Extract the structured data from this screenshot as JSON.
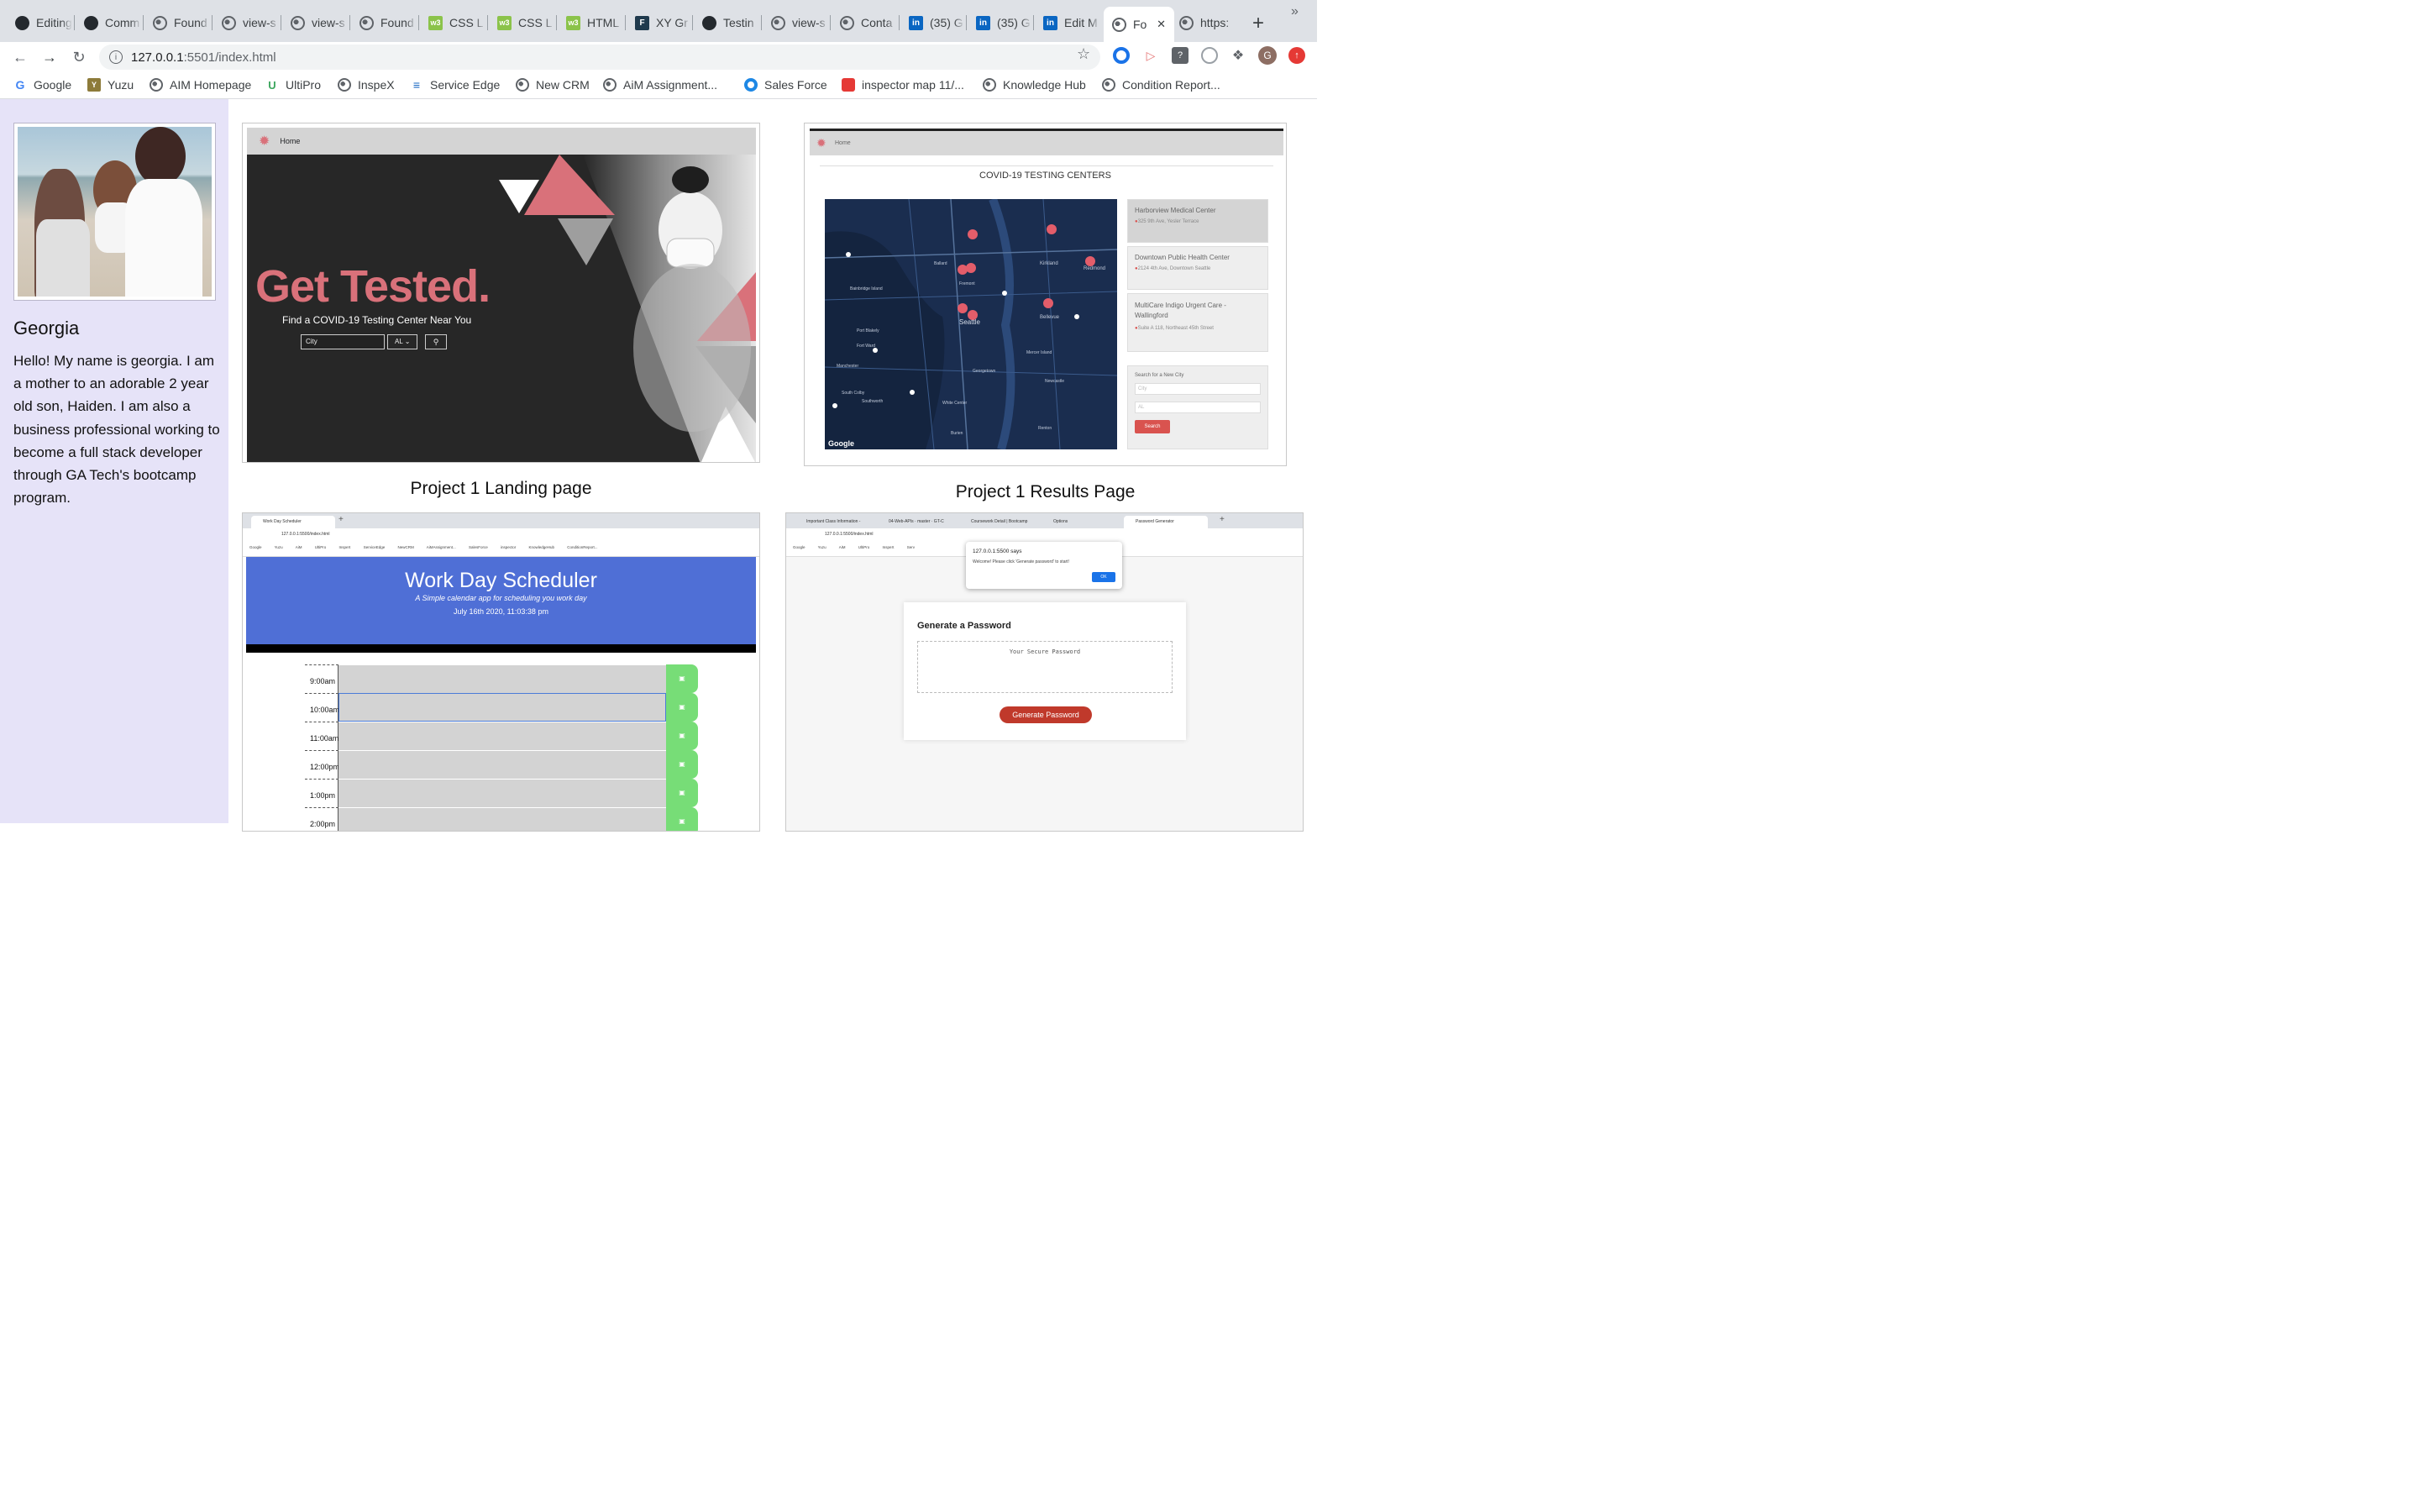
{
  "browser": {
    "tabs": [
      {
        "label": "Editing",
        "icon": "github-icon"
      },
      {
        "label": "Comm",
        "icon": "github-icon"
      },
      {
        "label": "Found",
        "icon": "globe-icon"
      },
      {
        "label": "view-s",
        "icon": "globe-icon"
      },
      {
        "label": "view-s",
        "icon": "globe-icon"
      },
      {
        "label": "Found",
        "icon": "globe-icon"
      },
      {
        "label": "CSS L",
        "icon": "w3schools-icon"
      },
      {
        "label": "CSS L",
        "icon": "w3schools-icon"
      },
      {
        "label": "HTML",
        "icon": "w3schools-icon"
      },
      {
        "label": "XY Gr",
        "icon": "figma-icon"
      },
      {
        "label": "Testin",
        "icon": "github-icon"
      },
      {
        "label": "view-s",
        "icon": "globe-icon"
      },
      {
        "label": "Conta",
        "icon": "globe-icon"
      },
      {
        "label": "(35) G",
        "icon": "linkedin-icon"
      },
      {
        "label": "(35) G",
        "icon": "linkedin-icon"
      },
      {
        "label": "Edit M",
        "icon": "linkedin-icon"
      },
      {
        "label": "Fo",
        "icon": "globe-icon",
        "active": true
      },
      {
        "label": "https:",
        "icon": "globe-icon"
      }
    ],
    "url": "127.0.0.1:5501/index.html",
    "url_host": "127.0.0.1",
    "url_rest": ":5501/index.html",
    "bookmarks": [
      "Google",
      "Yuzu",
      "AIM Homepage",
      "UltiPro",
      "InspeX",
      "Service Edge",
      "New CRM",
      "AiM Assignment...",
      "Sales Force",
      "inspector map 11/...",
      "Knowledge Hub",
      "Condition Report..."
    ],
    "bookmarks_more": "»",
    "profile_initial": "G"
  },
  "sidebar": {
    "name": "Georgia",
    "bio": "Hello! My name is georgia. I am a mother to an adorable 2 year old son, Haiden. I am also a business professional working to become a full stack developer through GA Tech's bootcamp program."
  },
  "projects": {
    "landing": {
      "caption": "Project 1 Landing page",
      "nav_home": "Home",
      "headline": "Get Tested.",
      "subhead": "Find a COVID-19 Testing Center Near You",
      "city_placeholder": "City",
      "state_value": "AL"
    },
    "results": {
      "caption": "Project 1 Results Page",
      "nav_home": "Home",
      "title": "COVID-19 TESTING CENTERS",
      "centers": [
        {
          "name": "Harborview Medical Center",
          "address": "325 9th Ave, Yesler Terrace"
        },
        {
          "name": "Downtown Public Health Center",
          "address": "2124 4th Ave, Downtown Seattle"
        },
        {
          "name": "MultiCare Indigo Urgent Care - Wallingford",
          "address": "Suite A 118, Northeast 45th Street"
        }
      ],
      "search_label": "Search for a New City",
      "city_placeholder": "City",
      "state_value": "AL",
      "search_button": "Search",
      "map_city": "Seattle",
      "map_places": [
        "Bellevue",
        "Kirkland",
        "Redmond",
        "Ballard",
        "Fremont",
        "Bainbridge Island",
        "Port Blakely",
        "Fort Ward",
        "Manchester",
        "South Colby",
        "Southworth",
        "Burien",
        "Renton",
        "Newcastle",
        "Mercer Island",
        "White Center",
        "Georgetown"
      ],
      "map_brand": "Google"
    },
    "scheduler": {
      "tab_label": "Work Day Scheduler",
      "url": "127.0.0.1:5500/index.html",
      "title": "Work Day Scheduler",
      "subtitle": "A Simple calendar app for scheduling you work day",
      "date": "July 16th 2020, 11:03:38 pm",
      "hours": [
        "9:00am",
        "10:00am",
        "11:00am",
        "12:00pm",
        "1:00pm",
        "2:00pm"
      ]
    },
    "password": {
      "tabs": [
        "Important Class Information -",
        "04-Web-APIs · master · GT-C",
        "Coursework Detail | Bootcamp",
        "Options",
        "Password Generator"
      ],
      "url": "127.0.0.1:5500/index.html",
      "alert_title": "127.0.0.1:5500 says",
      "alert_message": "Welcome! Please click 'Generate password' to start!",
      "alert_ok": "OK",
      "heading": "Generate a Password",
      "placeholder": "Your Secure Password",
      "button": "Generate Password"
    }
  },
  "colors": {
    "sidebar_bg": "#e6e3f8",
    "landing_pink": "#d9717a",
    "scheduler_blue": "#4f6fd6",
    "save_green": "#77dd77",
    "password_red": "#c0392b"
  }
}
